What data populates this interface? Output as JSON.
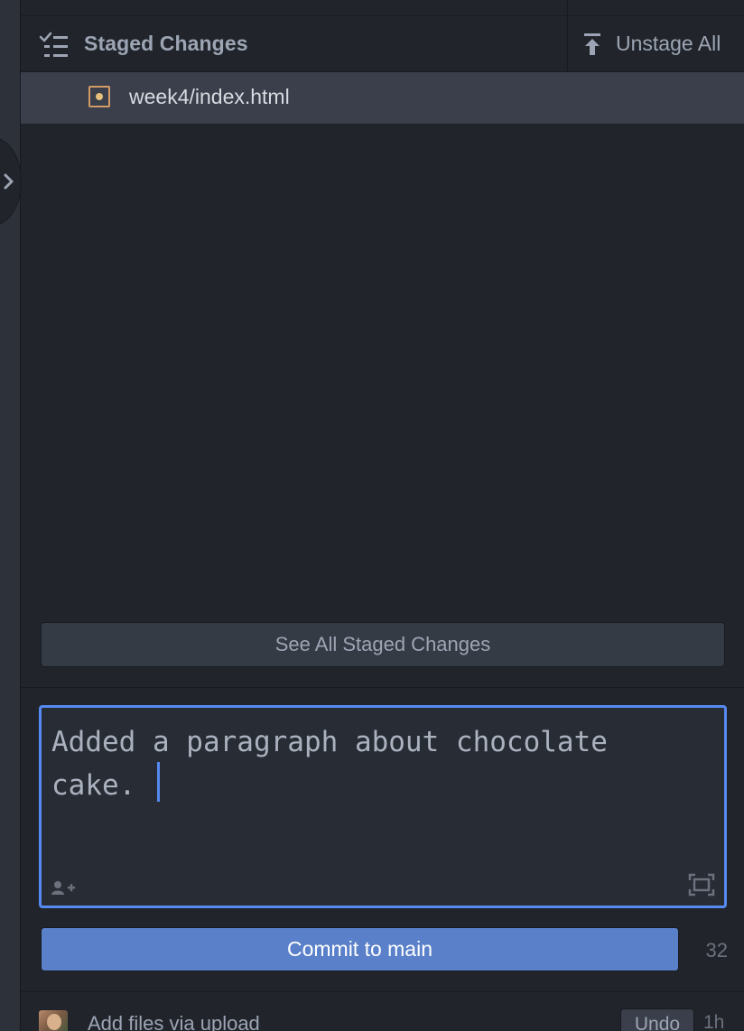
{
  "staged": {
    "title": "Staged Changes",
    "title_icon": "list-check-icon",
    "unstage_all_label": "Unstage All",
    "unstage_icon": "arrow-up-to-line-icon",
    "files": [
      {
        "name": "week4/index.html",
        "status": "modified",
        "status_color": "#e5c07b"
      }
    ],
    "see_all_label": "See All Staged Changes"
  },
  "commit": {
    "message": "Added a paragraph about chocolate\ncake. ",
    "button_label": "Commit to main",
    "char_count": "32",
    "accent_color": "#568af2",
    "button_color": "#5a80c9"
  },
  "recent_commit": {
    "message": "Add files via upload",
    "undo_label": "Undo",
    "time": "1h"
  },
  "colors": {
    "background": "#21252b",
    "selected_row": "#3a3f4b",
    "text": "#9da5b4"
  }
}
